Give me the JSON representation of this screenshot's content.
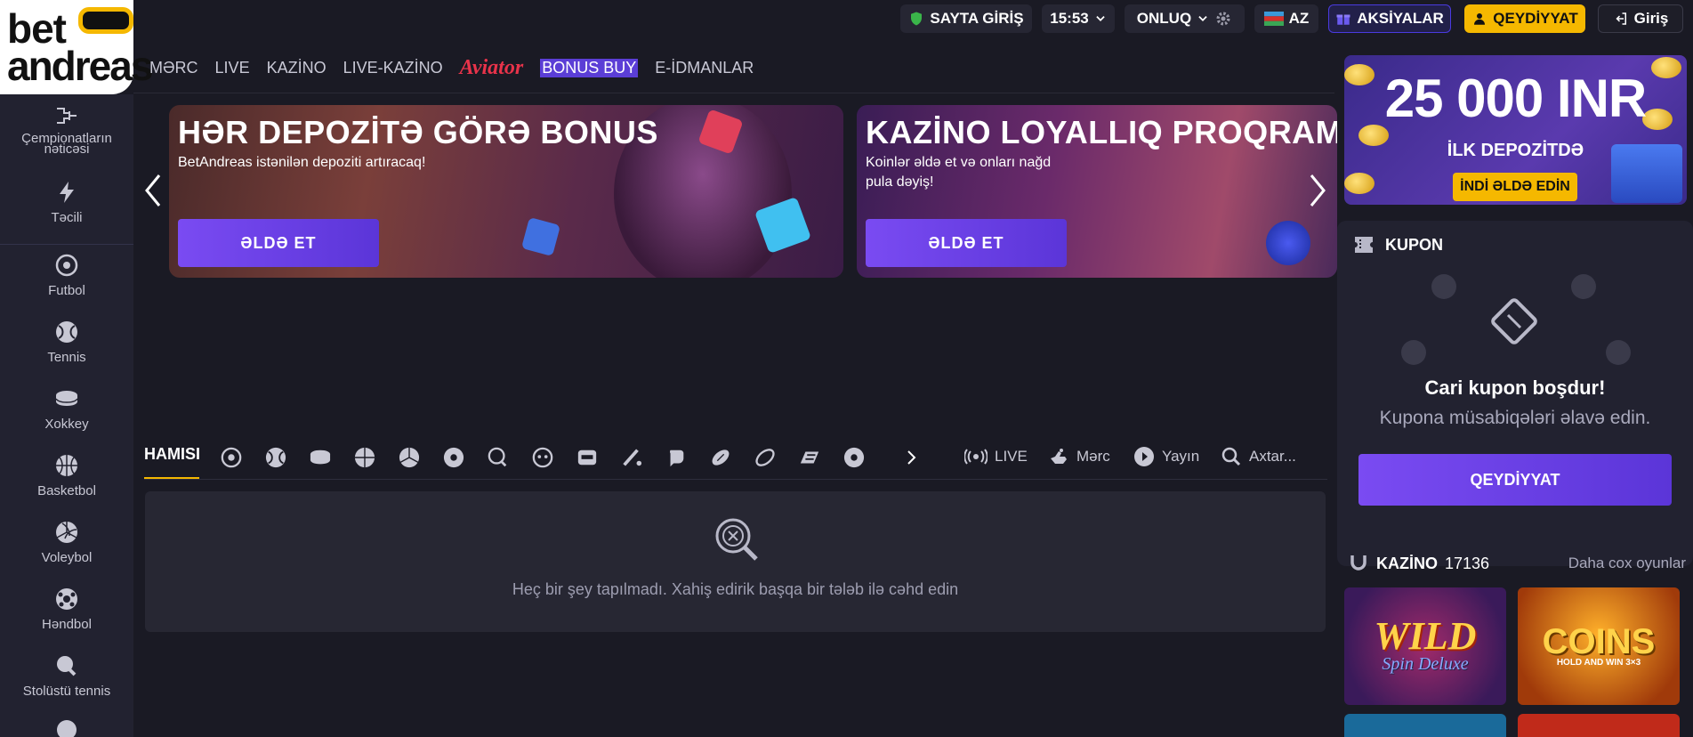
{
  "logo": {
    "line1": "bet",
    "line2": "andreas"
  },
  "topbar": {
    "site_login": "SAYTA GİRİŞ",
    "time": "15:53",
    "odds_format": "ONLUQ",
    "language": "AZ",
    "promotions": "AKSİYALAR",
    "register": "QEYDİYYAT",
    "login": "Giriş"
  },
  "nav": {
    "items": [
      "MƏRC",
      "LIVE",
      "KAZİNO",
      "LIVE-KAZİNO",
      "Aviator",
      "BONUS BUY",
      "E-İDMANLAR"
    ]
  },
  "sidebar": {
    "items": [
      {
        "label": "Çempionatların nəticəsi",
        "icon": "results-icon"
      },
      {
        "label": "Təcili",
        "icon": "lightning-icon"
      },
      {
        "label": "Futbol",
        "icon": "football-icon"
      },
      {
        "label": "Tennis",
        "icon": "tennis-icon"
      },
      {
        "label": "Xokkey",
        "icon": "hockey-icon"
      },
      {
        "label": "Basketbol",
        "icon": "basketball-icon"
      },
      {
        "label": "Voleybol",
        "icon": "volleyball-icon"
      },
      {
        "label": "Həndbol",
        "icon": "handball-icon"
      },
      {
        "label": "Stolüstü tennis",
        "icon": "table-tennis-icon"
      }
    ]
  },
  "banners": [
    {
      "title": "HƏR DEPOZİTƏ GÖRƏ BONUS",
      "text": "BetAndreas istənilən depoziti artıracaq!",
      "cta": "ƏLDƏ ET"
    },
    {
      "title": "KAZİNO LOYALLIQ PROQRAMI",
      "text": "Koinlər əldə et və onları nağd pula dəyiş!",
      "cta": "ƏLDƏ ET"
    }
  ],
  "sports_bar": {
    "all_label": "HAMISI",
    "live_label": "LIVE",
    "bet_label": "Mərc",
    "stream_label": "Yayın",
    "search_label": "Axtar..."
  },
  "empty_state": {
    "message": "Heç bir şey tapılmadı. Xahiş edirik başqa bir tələb ilə cəhd edin"
  },
  "promo": {
    "amount": "25 000 INR",
    "subtitle": "İLK DEPOZİTDƏ",
    "button": "İNDİ ƏLDƏ EDİN"
  },
  "kupon": {
    "title": "KUPON",
    "empty_title": "Cari kupon boşdur!",
    "empty_sub": "Kupona müsabiqələri əlavə edin.",
    "register": "QEYDİYYAT"
  },
  "kazino": {
    "title": "KAZİNO",
    "count": "17136",
    "more": "Daha cox oyunlar",
    "games": [
      {
        "title": "WILD",
        "subtitle": "Spin Deluxe"
      },
      {
        "title": "COINS",
        "subtitle": "HOLD AND WIN 3×3"
      }
    ]
  },
  "colors": {
    "accent_yellow": "#f5b800",
    "accent_purple": "#6a40e6",
    "background": "#1a1a24",
    "panel": "#222230"
  }
}
